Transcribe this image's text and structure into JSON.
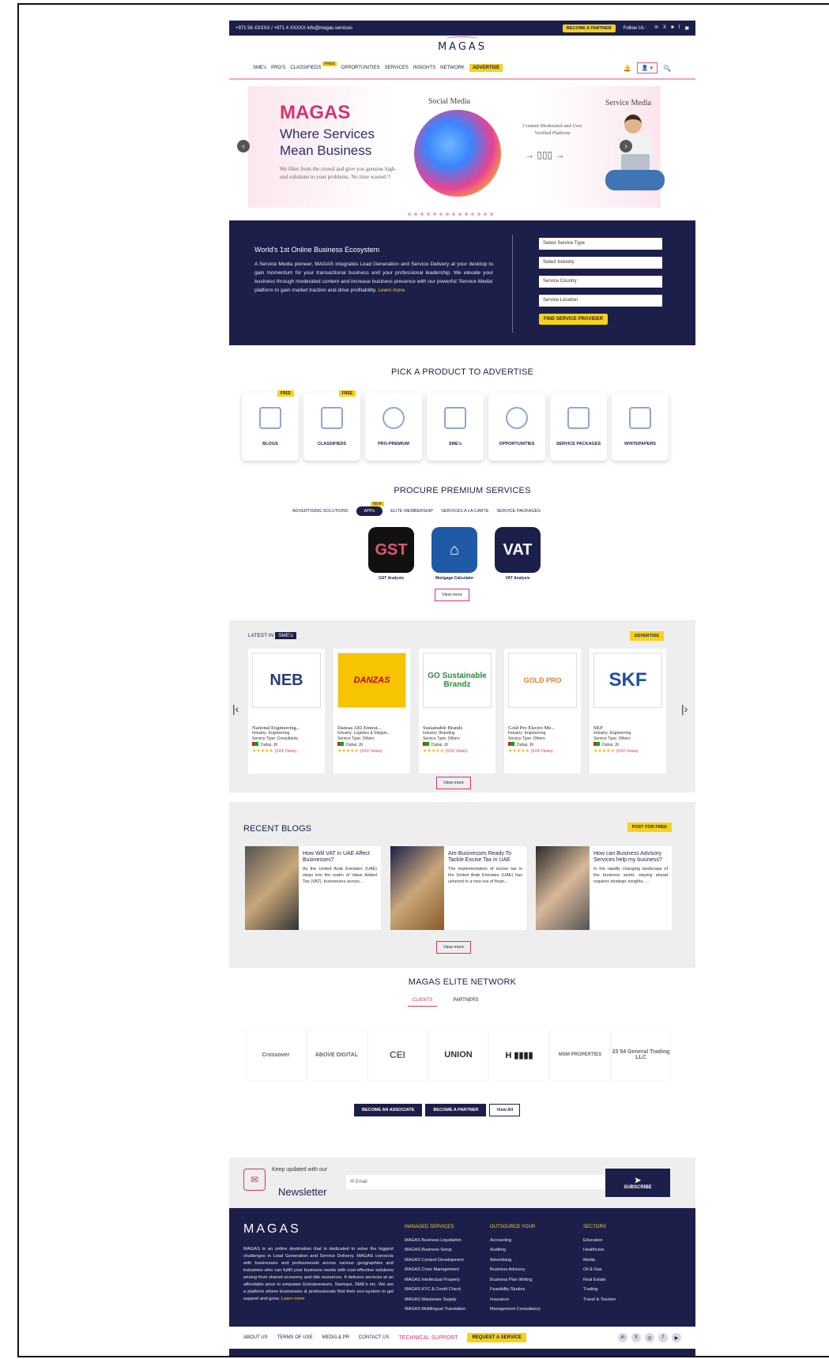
{
  "topbar": {
    "contact": "+971 56 XXXXX / +971 4 XXXXX   info@magas.services",
    "cta": "BECOME A PARTNER",
    "follow": "Follow Us :",
    "social": [
      "in",
      "X",
      "■",
      "f",
      "▣"
    ]
  },
  "brand": {
    "logo": "MAGAS"
  },
  "nav": {
    "items": [
      "SME's",
      "PRO'S",
      "CLASSIFIEDS",
      "OPPORTUNITIES",
      "SERVICES",
      "INSIGHTS",
      "NETWORK"
    ],
    "free_tag": "FREE",
    "advertise": "ADVERTISE",
    "bell": "🔔",
    "account": "👤 ▾",
    "search": "🔍"
  },
  "hero": {
    "title": "MAGAS",
    "subtitle": "Where Services Mean Business",
    "desc": "We filter from the crowd and give you genuine high-end solutions to your problems. No time wasted !!",
    "social_title": "Social Media",
    "service_title": "Service Media",
    "mid_text": "Content Moderated and User Verified Platform",
    "arrows": "→  ▯▯▯  →",
    "prev": "‹",
    "next": "›"
  },
  "intro": {
    "title": "World's 1st Online Business Ecosystem",
    "text": "A Service Media pioneer, MAGAS integrates Lead Generation and Service Delivery at your desktop to gain momentum for your transactional business and your professional leadership. We elevate your business through moderated content and increase business presence with our powerful 'Service Media' platform to gain market traction and drive profitability.",
    "more": "Learn more",
    "selects": [
      "Select Service Type",
      "Select Industry",
      "Service Country",
      "Service Location"
    ],
    "find": "FIND SERVICE PROVIDER"
  },
  "pick": {
    "title": "PICK A PRODUCT TO ADVERTISE",
    "products": [
      {
        "label": "BLOGS",
        "free": "FREE"
      },
      {
        "label": "CLASSIFIEDS",
        "free": "FREE"
      },
      {
        "label": "PRO-PREMIUM",
        "free": ""
      },
      {
        "label": "SME's",
        "free": ""
      },
      {
        "label": "OPPORTUNITIES",
        "free": ""
      },
      {
        "label": "SERVICE PACKAGES",
        "free": ""
      },
      {
        "label": "WHITEPAPERS",
        "free": ""
      }
    ]
  },
  "procure": {
    "title": "PROCURE PREMIUM SERVICES",
    "tabs": [
      "ADVERTISING SOLUTIONS",
      "APPs",
      "ELITE MEMBERSHIP",
      "SERVICES A LA CARTE",
      "SERVICE PACKAGES"
    ],
    "new_tag": "NEW",
    "apps": [
      {
        "name": "GST Analysis",
        "tile": "GST",
        "color": "#111111"
      },
      {
        "name": "Mortgage Calculator",
        "tile": "⌂",
        "color": "#1f5aa6"
      },
      {
        "name": "VAT Analysis",
        "tile": "VAT",
        "color": "#1c1f4a"
      }
    ],
    "view_more": "View more"
  },
  "latest": {
    "label": "LATEST IN",
    "tag": "SME's",
    "advertise": "ADVERTISE",
    "prev": "|‹",
    "next": "|›",
    "cards": [
      {
        "logo": "NEB",
        "name": "National Engineering...",
        "industry": "Industry: Engineering",
        "type": "Service Type: Consultants",
        "loc": "Dubai, Jlt",
        "views": "(XXX Views)",
        "bg": "#ffffff",
        "fg": "#2a3a7a"
      },
      {
        "logo": "DANZAS",
        "name": "Danzas AEI Emirat...",
        "industry": "Industry: Logistics & Shippin...",
        "type": "Service Type: Others",
        "loc": "Dubai, Jlt",
        "views": "(XXX Views)",
        "bg": "#f6c400",
        "fg": "#c40000"
      },
      {
        "logo": "GO Sustainable Brandz",
        "name": "Sustainable Brands",
        "industry": "Industry: Branding",
        "type": "Service Type: Others",
        "loc": "Dubai, Jlt",
        "views": "(XXX Views)",
        "bg": "#ffffff",
        "fg": "#2a8a3a"
      },
      {
        "logo": "GOLD PRO",
        "name": "Gold Pro Electro Me...",
        "industry": "Industry: Engineering",
        "type": "Service Type: Others",
        "loc": "Dubai, Jlt",
        "views": "(XXX Views)",
        "bg": "#ffffff",
        "fg": "#d9822b"
      },
      {
        "logo": "SKF",
        "name": "SKF",
        "industry": "Industry: Engineering",
        "type": "Service Type: Others",
        "loc": "Dubai, Jlt",
        "views": "(XXX Views)",
        "bg": "#ffffff",
        "fg": "#1f4fa3"
      }
    ],
    "view_more": "View more"
  },
  "blogs": {
    "title": "RECENT BLOGS",
    "post": "POST FOR FREE",
    "items": [
      {
        "title": "How Will VAT in UAE Affect Businesses?",
        "desc": "As the United Arab Emirates (UAE) steps into the realm of Value Added Tax (VAT), businesses across..."
      },
      {
        "title": "Are Businesses Ready To Tackle Excise Tax in UAE",
        "desc": "The implementation of excise tax in the United Arab Emirates (UAE) has ushered in a new era of finan..."
      },
      {
        "title": "How can Business Advisory Services help my business?",
        "desc": "In the rapidly changing landscape of the business world, staying ahead requires strategic insights, ..."
      }
    ],
    "view_more": "View more"
  },
  "elite": {
    "title": "MAGAS ELITE NETWORK",
    "tabs": [
      "CLIENTS",
      "PARTNERS"
    ],
    "logos": [
      "Crossover",
      "ABOVE DIGITAL",
      "CEI",
      "UNION",
      "H ▮▮▮▮",
      "MSM PROPERTIES",
      "23 54 General Trading LLC"
    ],
    "btn_associate": "BECOME AN ASSOCIATE",
    "btn_partner": "BECOME A PARTNER",
    "btn_all": "View All"
  },
  "newsletter": {
    "small": "Keep updated with our",
    "big": "Newsletter",
    "placeholder": "✉ Email",
    "subscribe": "SUBSCRIBE"
  },
  "footer": {
    "logo": "MAGAS",
    "desc": "MAGAS is an online destination that is dedicated to solve the biggest challenges in Lead Generation and Service Delivery. MAGAS connects with businesses and professionals across various geographies and industries who can fulfill your business needs with cost-effective solutions arising from shared economy and idle resources. It delivers services at an affordable price to empower Entrepreneurs, Startups, SME's etc. We are a platform where businesses & professionals find their eco-system to get support and grow.",
    "more": "Learn more",
    "col1": {
      "h": "MANAGED SERVICES",
      "items": [
        "MAGAS Business Liquidation",
        "MAGAS Business Setup",
        "MAGAS Content Development",
        "MAGAS Crisis Management",
        "MAGAS Intellectual Property",
        "MAGAS KYC & Credit Check",
        "MAGAS Manpower Supply",
        "MAGAS Multilingual Translation"
      ]
    },
    "col2": {
      "h": "OUTSOURCE YOUR",
      "items": [
        "Accounting",
        "Auditing",
        "Advertising",
        "Business Advisory",
        "Business Plan Writing",
        "Feasibility Studies",
        "Insurance",
        "Management Consultancy"
      ]
    },
    "col3": {
      "h": "SECTORS",
      "items": [
        "Education",
        "Healthcare",
        "Media",
        "Oil & Gas",
        "Real Estate",
        "Trading",
        "Travel & Tourism"
      ]
    },
    "links": [
      "ABOUT US",
      "TERMS OF USE",
      "MEDIA & PR",
      "CONTACT US"
    ],
    "tech": "TECHNICAL SUPPORT",
    "request": "REQUEST A SERVICE",
    "social": [
      "in",
      "X",
      "◎",
      "f",
      "▶"
    ]
  }
}
